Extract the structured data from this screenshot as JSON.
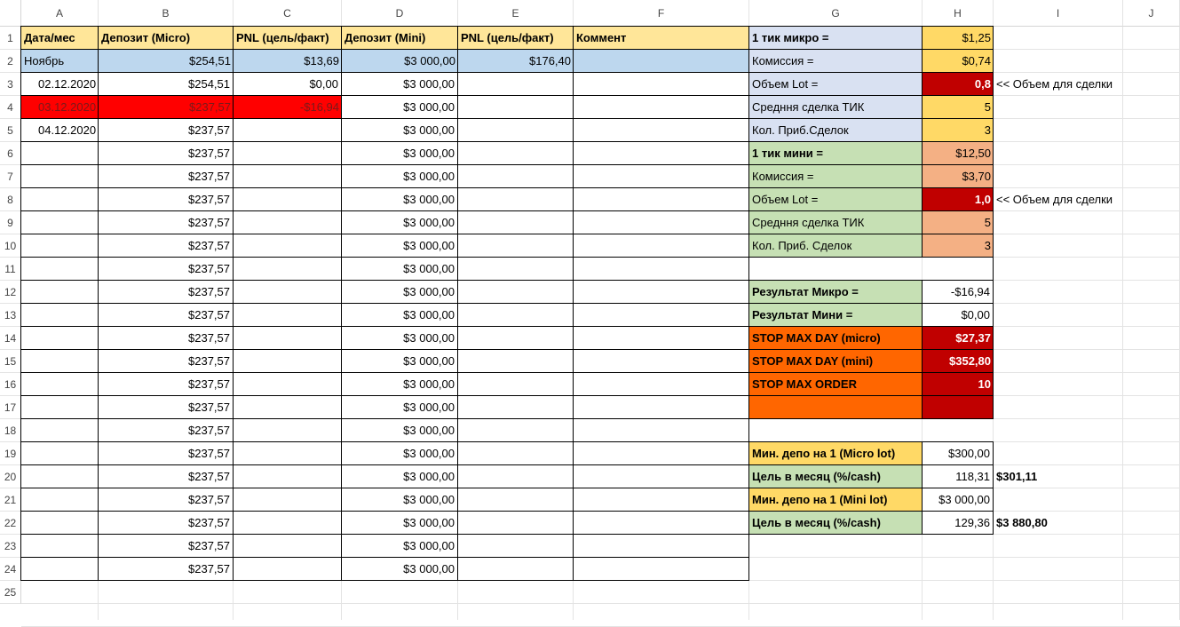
{
  "columns": [
    "A",
    "B",
    "C",
    "D",
    "E",
    "F",
    "G",
    "H",
    "I",
    "J"
  ],
  "rows": [
    "1",
    "2",
    "3",
    "4",
    "5",
    "6",
    "7",
    "8",
    "9",
    "10",
    "11",
    "12",
    "13",
    "14",
    "15",
    "16",
    "17",
    "18",
    "19",
    "20",
    "21",
    "22",
    "23",
    "24",
    "25"
  ],
  "colors": {
    "header_yellow": "#ffe699",
    "nov_blue": "#bdd7ee",
    "red_row": "#ff0000",
    "lavender": "#d9e1f2",
    "gold": "#ffd966",
    "dark_red": "#c00000",
    "green": "#c6e0b4",
    "peach": "#f4b084",
    "orange": "#ff6600"
  },
  "left_table": {
    "headers": [
      "Дата/мес",
      "Депозит (Micro)",
      "PNL (цель/факт)",
      "Депозит (Mini)",
      "PNL (цель/факт)",
      "Коммент"
    ],
    "november_row": [
      "Ноябрь",
      "$254,51",
      "$13,69",
      "$3 000,00",
      "$176,40",
      ""
    ],
    "rows": [
      [
        "02.12.2020",
        "$254,51",
        "$0,00",
        "$3 000,00",
        "",
        ""
      ],
      [
        "03.12.2020",
        "$237,57",
        "-$16,94",
        "$3 000,00",
        "",
        ""
      ],
      [
        "04.12.2020",
        "$237,57",
        "",
        "$3 000,00",
        "",
        ""
      ],
      [
        "",
        "$237,57",
        "",
        "$3 000,00",
        "",
        ""
      ],
      [
        "",
        "$237,57",
        "",
        "$3 000,00",
        "",
        ""
      ],
      [
        "",
        "$237,57",
        "",
        "$3 000,00",
        "",
        ""
      ],
      [
        "",
        "$237,57",
        "",
        "$3 000,00",
        "",
        ""
      ],
      [
        "",
        "$237,57",
        "",
        "$3 000,00",
        "",
        ""
      ],
      [
        "",
        "$237,57",
        "",
        "$3 000,00",
        "",
        ""
      ],
      [
        "",
        "$237,57",
        "",
        "$3 000,00",
        "",
        ""
      ],
      [
        "",
        "$237,57",
        "",
        "$3 000,00",
        "",
        ""
      ],
      [
        "",
        "$237,57",
        "",
        "$3 000,00",
        "",
        ""
      ],
      [
        "",
        "$237,57",
        "",
        "$3 000,00",
        "",
        ""
      ],
      [
        "",
        "$237,57",
        "",
        "$3 000,00",
        "",
        ""
      ],
      [
        "",
        "$237,57",
        "",
        "$3 000,00",
        "",
        ""
      ],
      [
        "",
        "$237,57",
        "",
        "$3 000,00",
        "",
        ""
      ],
      [
        "",
        "$237,57",
        "",
        "$3 000,00",
        "",
        ""
      ],
      [
        "",
        "$237,57",
        "",
        "$3 000,00",
        "",
        ""
      ],
      [
        "",
        "$237,57",
        "",
        "$3 000,00",
        "",
        ""
      ],
      [
        "",
        "$237,57",
        "",
        "$3 000,00",
        "",
        ""
      ],
      [
        "",
        "$237,57",
        "",
        "$3 000,00",
        "",
        ""
      ],
      [
        "",
        "$237,57",
        "",
        "$3 000,00",
        "",
        ""
      ]
    ]
  },
  "right_panel": {
    "micro_tick_label": "1 тик микро =",
    "micro_tick_value": "$1,25",
    "micro_commission_label": "Комиссия =",
    "micro_commission_value": "$0,74",
    "micro_lot_label": "Объем  Lot =",
    "micro_lot_value": "0,8",
    "micro_lot_note": "<< Объем для сделки",
    "micro_avg_label": "Средння сделка ТИК",
    "micro_avg_value": "5",
    "micro_count_label": "Кол. Приб.Сделок",
    "micro_count_value": "3",
    "mini_tick_label": "1 тик мини =",
    "mini_tick_value": "$12,50",
    "mini_commission_label": "Комиссия =",
    "mini_commission_value": "$3,70",
    "mini_lot_label": "Объем  Lot =",
    "mini_lot_value": "1,0",
    "mini_lot_note": "<< Объем для сделки",
    "mini_avg_label": "Средння сделка ТИК",
    "mini_avg_value": "5",
    "mini_count_label": "Кол. Приб. Сделок",
    "mini_count_value": "3",
    "result_micro_label": "Результат Микро =",
    "result_micro_value": "-$16,94",
    "result_mini_label": "Результат Мини =",
    "result_mini_value": "$0,00",
    "stop_day_micro_label": "STOP MAX DAY (micro)",
    "stop_day_micro_value": "$27,37",
    "stop_day_mini_label": "STOP MAX DAY (mini)",
    "stop_day_mini_value": "$352,80",
    "stop_order_label": "STOP MAX ORDER",
    "stop_order_value": "10",
    "min_depo_micro_label": "Мин. депо на 1 (Micro lot)",
    "min_depo_micro_value": "$300,00",
    "goal_micro_label": "Цель в месяц (%/cash)",
    "goal_micro_value": "118,31",
    "goal_micro_cash": "$301,11",
    "min_depo_mini_label": "Мин. депо на 1 (Mini lot)",
    "min_depo_mini_value": "$3 000,00",
    "goal_mini_label": "Цель в месяц (%/cash)",
    "goal_mini_value": "129,36",
    "goal_mini_cash": "$3 880,80"
  }
}
